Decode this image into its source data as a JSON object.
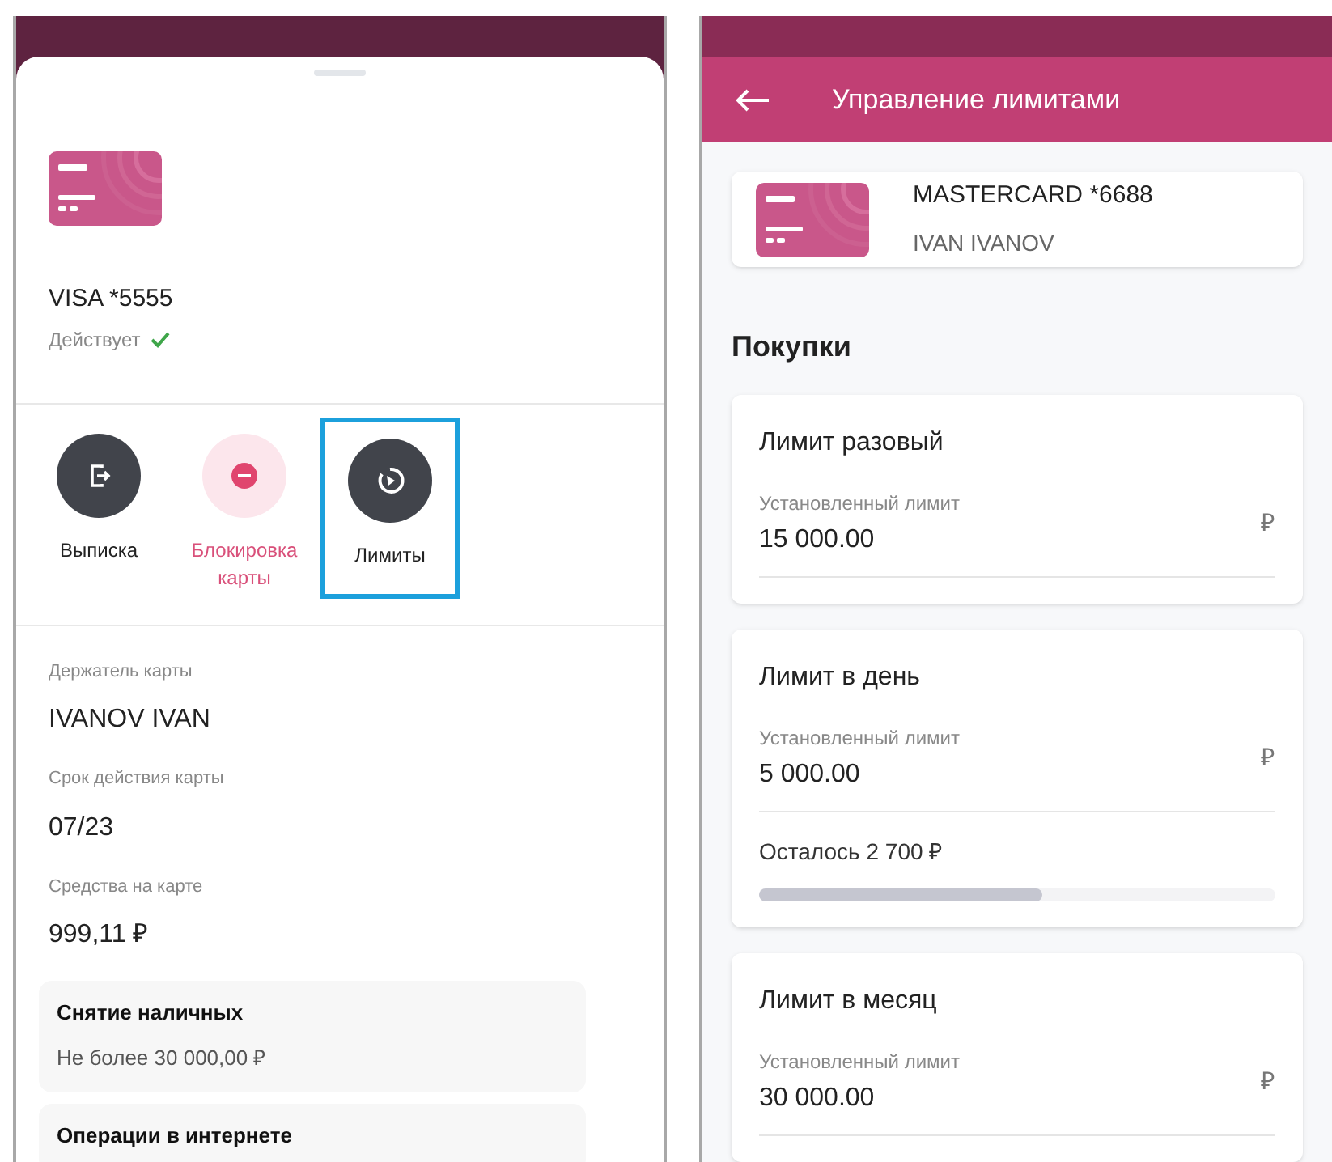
{
  "card_sheet": {
    "card": {
      "name": "VISA *5555",
      "status": "Действует",
      "active": true
    },
    "actions": [
      {
        "label": "Выписка",
        "kind": "neutral",
        "highlighted": false
      },
      {
        "label": "Блокировка карты",
        "kind": "danger",
        "highlighted": false
      },
      {
        "label": "Лимиты",
        "kind": "neutral",
        "highlighted": true
      }
    ],
    "fields": [
      {
        "label": "Держатель карты",
        "value": "IVANOV IVAN"
      },
      {
        "label": "Срок действия карты",
        "value": "07/23"
      },
      {
        "label": "Средства на карте",
        "value": "999,11 ₽"
      }
    ],
    "limits": [
      {
        "title": "Снятие наличных",
        "value": "Не более 30 000,00 ₽"
      },
      {
        "title": "Операции в интернете"
      }
    ]
  },
  "limits_screen": {
    "title": "Управление лимитами",
    "card": {
      "name": "MASTERCARD *6688",
      "holder": "IVAN IVANOV"
    },
    "section": "Покупки",
    "limits": [
      {
        "title": "Лимит разовый",
        "label": "Установленный лимит",
        "value": "15 000.00",
        "currency": "₽"
      },
      {
        "title": "Лимит в день",
        "label": "Установленный лимит",
        "value": "5 000.00",
        "currency": "₽",
        "remaining": "Осталось 2 700 ₽",
        "level": 0.55
      },
      {
        "title": "Лимит в месяц",
        "label": "Установленный лимит",
        "value": "30 000.00",
        "currency": "₽"
      }
    ]
  }
}
